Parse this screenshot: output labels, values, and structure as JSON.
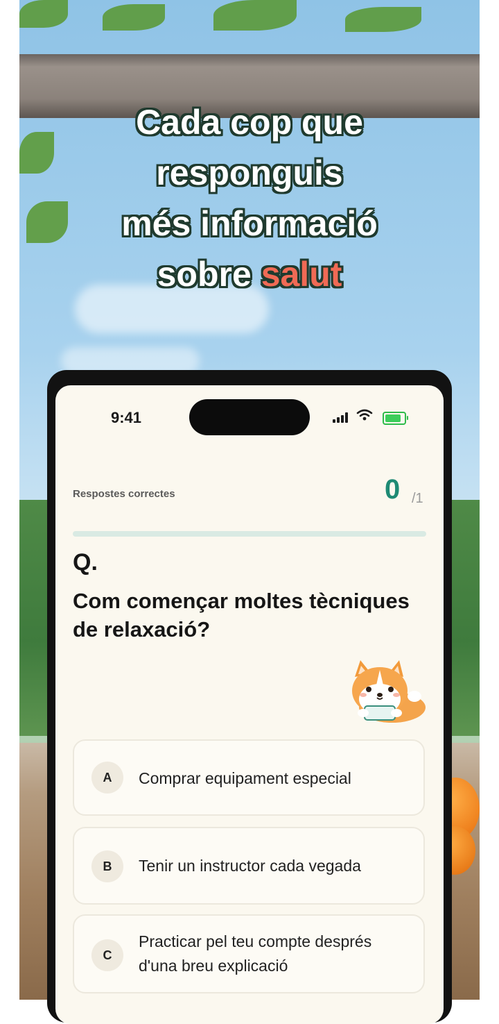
{
  "headline": {
    "line1": "Cada cop que",
    "line2": "responguis",
    "line3": "més informació",
    "line4_prefix": "sobre",
    "line4_highlight": "salut",
    "highlight_color": "#f06a55"
  },
  "phone": {
    "status_bar": {
      "time": "9:41",
      "icons": [
        "cellular-signal-icon",
        "wifi-icon",
        "battery-charging-icon"
      ]
    },
    "score": {
      "label": "Respostes correctes",
      "correct": "0",
      "total": "/1",
      "progress": 0
    },
    "question": {
      "marker": "Q.",
      "text": "Com començar moltes tècniques de relaxació?"
    },
    "mascot": "corgi-mascot",
    "options": [
      {
        "letter": "A",
        "text": "Comprar equipament especial"
      },
      {
        "letter": "B",
        "text": "Tenir un instructor cada vegada"
      },
      {
        "letter": "C",
        "text": "Practicar pel teu compte després d'una breu explicació"
      }
    ],
    "accent_color": "#1e8a74"
  }
}
